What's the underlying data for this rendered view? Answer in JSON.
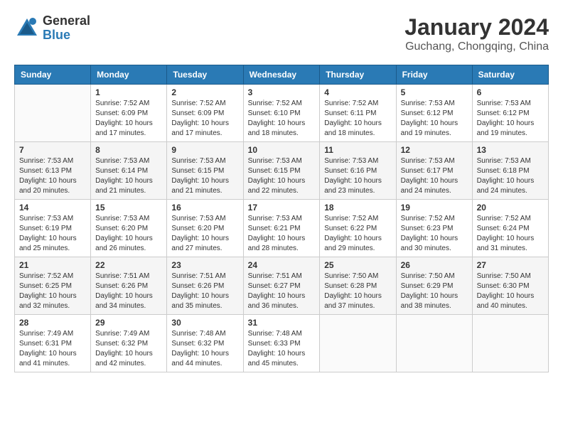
{
  "logo": {
    "general": "General",
    "blue": "Blue"
  },
  "header": {
    "title": "January 2024",
    "subtitle": "Guchang, Chongqing, China"
  },
  "days_of_week": [
    "Sunday",
    "Monday",
    "Tuesday",
    "Wednesday",
    "Thursday",
    "Friday",
    "Saturday"
  ],
  "weeks": [
    {
      "cells": [
        {
          "day": "",
          "info": ""
        },
        {
          "day": "1",
          "info": "Sunrise: 7:52 AM\nSunset: 6:09 PM\nDaylight: 10 hours\nand 17 minutes."
        },
        {
          "day": "2",
          "info": "Sunrise: 7:52 AM\nSunset: 6:09 PM\nDaylight: 10 hours\nand 17 minutes."
        },
        {
          "day": "3",
          "info": "Sunrise: 7:52 AM\nSunset: 6:10 PM\nDaylight: 10 hours\nand 18 minutes."
        },
        {
          "day": "4",
          "info": "Sunrise: 7:52 AM\nSunset: 6:11 PM\nDaylight: 10 hours\nand 18 minutes."
        },
        {
          "day": "5",
          "info": "Sunrise: 7:53 AM\nSunset: 6:12 PM\nDaylight: 10 hours\nand 19 minutes."
        },
        {
          "day": "6",
          "info": "Sunrise: 7:53 AM\nSunset: 6:12 PM\nDaylight: 10 hours\nand 19 minutes."
        }
      ]
    },
    {
      "cells": [
        {
          "day": "7",
          "info": "Sunrise: 7:53 AM\nSunset: 6:13 PM\nDaylight: 10 hours\nand 20 minutes."
        },
        {
          "day": "8",
          "info": "Sunrise: 7:53 AM\nSunset: 6:14 PM\nDaylight: 10 hours\nand 21 minutes."
        },
        {
          "day": "9",
          "info": "Sunrise: 7:53 AM\nSunset: 6:15 PM\nDaylight: 10 hours\nand 21 minutes."
        },
        {
          "day": "10",
          "info": "Sunrise: 7:53 AM\nSunset: 6:15 PM\nDaylight: 10 hours\nand 22 minutes."
        },
        {
          "day": "11",
          "info": "Sunrise: 7:53 AM\nSunset: 6:16 PM\nDaylight: 10 hours\nand 23 minutes."
        },
        {
          "day": "12",
          "info": "Sunrise: 7:53 AM\nSunset: 6:17 PM\nDaylight: 10 hours\nand 24 minutes."
        },
        {
          "day": "13",
          "info": "Sunrise: 7:53 AM\nSunset: 6:18 PM\nDaylight: 10 hours\nand 24 minutes."
        }
      ]
    },
    {
      "cells": [
        {
          "day": "14",
          "info": "Sunrise: 7:53 AM\nSunset: 6:19 PM\nDaylight: 10 hours\nand 25 minutes."
        },
        {
          "day": "15",
          "info": "Sunrise: 7:53 AM\nSunset: 6:20 PM\nDaylight: 10 hours\nand 26 minutes."
        },
        {
          "day": "16",
          "info": "Sunrise: 7:53 AM\nSunset: 6:20 PM\nDaylight: 10 hours\nand 27 minutes."
        },
        {
          "day": "17",
          "info": "Sunrise: 7:53 AM\nSunset: 6:21 PM\nDaylight: 10 hours\nand 28 minutes."
        },
        {
          "day": "18",
          "info": "Sunrise: 7:52 AM\nSunset: 6:22 PM\nDaylight: 10 hours\nand 29 minutes."
        },
        {
          "day": "19",
          "info": "Sunrise: 7:52 AM\nSunset: 6:23 PM\nDaylight: 10 hours\nand 30 minutes."
        },
        {
          "day": "20",
          "info": "Sunrise: 7:52 AM\nSunset: 6:24 PM\nDaylight: 10 hours\nand 31 minutes."
        }
      ]
    },
    {
      "cells": [
        {
          "day": "21",
          "info": "Sunrise: 7:52 AM\nSunset: 6:25 PM\nDaylight: 10 hours\nand 32 minutes."
        },
        {
          "day": "22",
          "info": "Sunrise: 7:51 AM\nSunset: 6:26 PM\nDaylight: 10 hours\nand 34 minutes."
        },
        {
          "day": "23",
          "info": "Sunrise: 7:51 AM\nSunset: 6:26 PM\nDaylight: 10 hours\nand 35 minutes."
        },
        {
          "day": "24",
          "info": "Sunrise: 7:51 AM\nSunset: 6:27 PM\nDaylight: 10 hours\nand 36 minutes."
        },
        {
          "day": "25",
          "info": "Sunrise: 7:50 AM\nSunset: 6:28 PM\nDaylight: 10 hours\nand 37 minutes."
        },
        {
          "day": "26",
          "info": "Sunrise: 7:50 AM\nSunset: 6:29 PM\nDaylight: 10 hours\nand 38 minutes."
        },
        {
          "day": "27",
          "info": "Sunrise: 7:50 AM\nSunset: 6:30 PM\nDaylight: 10 hours\nand 40 minutes."
        }
      ]
    },
    {
      "cells": [
        {
          "day": "28",
          "info": "Sunrise: 7:49 AM\nSunset: 6:31 PM\nDaylight: 10 hours\nand 41 minutes."
        },
        {
          "day": "29",
          "info": "Sunrise: 7:49 AM\nSunset: 6:32 PM\nDaylight: 10 hours\nand 42 minutes."
        },
        {
          "day": "30",
          "info": "Sunrise: 7:48 AM\nSunset: 6:32 PM\nDaylight: 10 hours\nand 44 minutes."
        },
        {
          "day": "31",
          "info": "Sunrise: 7:48 AM\nSunset: 6:33 PM\nDaylight: 10 hours\nand 45 minutes."
        },
        {
          "day": "",
          "info": ""
        },
        {
          "day": "",
          "info": ""
        },
        {
          "day": "",
          "info": ""
        }
      ]
    }
  ]
}
